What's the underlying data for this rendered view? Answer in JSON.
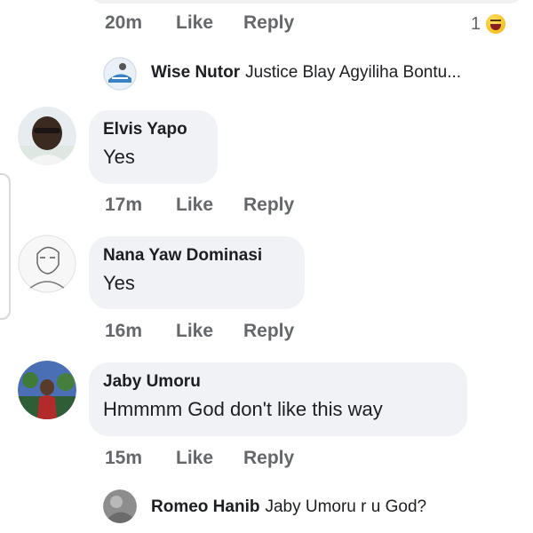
{
  "colors": {
    "bubble": "#f0f2f5",
    "meta_text": "#65676b",
    "primary_text": "#1c1e21",
    "haha_reaction": "#f7c52b"
  },
  "labels": {
    "like": "Like",
    "reply": "Reply"
  },
  "top_comment": {
    "time": "20m",
    "reaction_count": "1",
    "reaction_icon": "haha-icon"
  },
  "replies": [
    {
      "name": "Wise Nutor",
      "text": "Justice Blay Agyiliha Bontu..."
    },
    {
      "name": "Romeo Hanib",
      "text": "Jaby Umoru r u God?"
    }
  ],
  "comments": [
    {
      "name": "Elvis Yapo",
      "text": "Yes",
      "time": "17m"
    },
    {
      "name": "Nana Yaw Dominasi",
      "text": "Yes",
      "time": "16m"
    },
    {
      "name": "Jaby Umoru",
      "text": "Hmmmm God don't like this way",
      "time": "15m"
    }
  ]
}
